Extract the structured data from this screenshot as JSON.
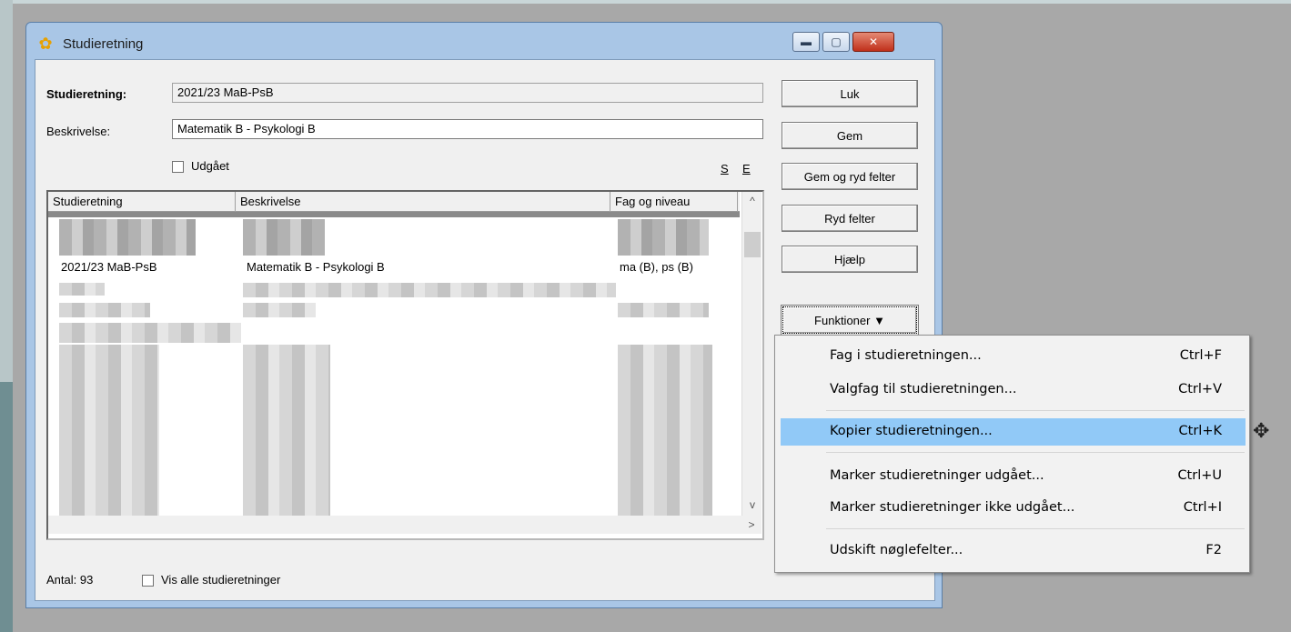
{
  "window": {
    "title": "Studieretning",
    "controls": {
      "minimize": "▬",
      "maximize": "▢",
      "close": "✕"
    }
  },
  "form": {
    "studieretning_label": "Studieretning:",
    "studieretning_value": "2021/23 MaB-PsB",
    "beskrivelse_label": "Beskrivelse:",
    "beskrivelse_value": "Matematik B - Psykologi B",
    "udgaaet_label": "Udgået",
    "s_label": "S",
    "e_label": "E"
  },
  "grid": {
    "columns": [
      "Studieretning",
      "Beskrivelse",
      "Fag og niveau"
    ],
    "visible_row": {
      "studieretning": "2021/23 MaB-PsB",
      "beskrivelse": "Matematik B - Psykologi B",
      "fag": "ma (B), ps (B)"
    },
    "scroll_up": "^",
    "scroll_down": "v",
    "scroll_right": ">"
  },
  "buttons": {
    "luk": "Luk",
    "gem": "Gem",
    "gem_ryd": "Gem og ryd felter",
    "ryd": "Ryd felter",
    "hjaelp": "Hjælp",
    "funktioner": "Funktioner ▼"
  },
  "footer": {
    "antal": "Antal: 93",
    "vis_alle": "Vis alle studieretninger"
  },
  "menu": {
    "items": [
      {
        "label": "Fag i studieretningen...",
        "shortcut": "Ctrl+F"
      },
      {
        "label": "Valgfag til studieretningen...",
        "shortcut": "Ctrl+V"
      },
      {
        "label": "Kopier studieretningen...",
        "shortcut": "Ctrl+K"
      },
      {
        "label": "Marker studieretninger udgået...",
        "shortcut": "Ctrl+U"
      },
      {
        "label": "Marker studieretninger ikke udgået...",
        "shortcut": "Ctrl+I"
      },
      {
        "label": "Udskift nøglefelter...",
        "shortcut": "F2"
      }
    ]
  },
  "colors": {
    "menu_highlight": "#91c9f7",
    "window_frame": "#a9c6e6"
  }
}
